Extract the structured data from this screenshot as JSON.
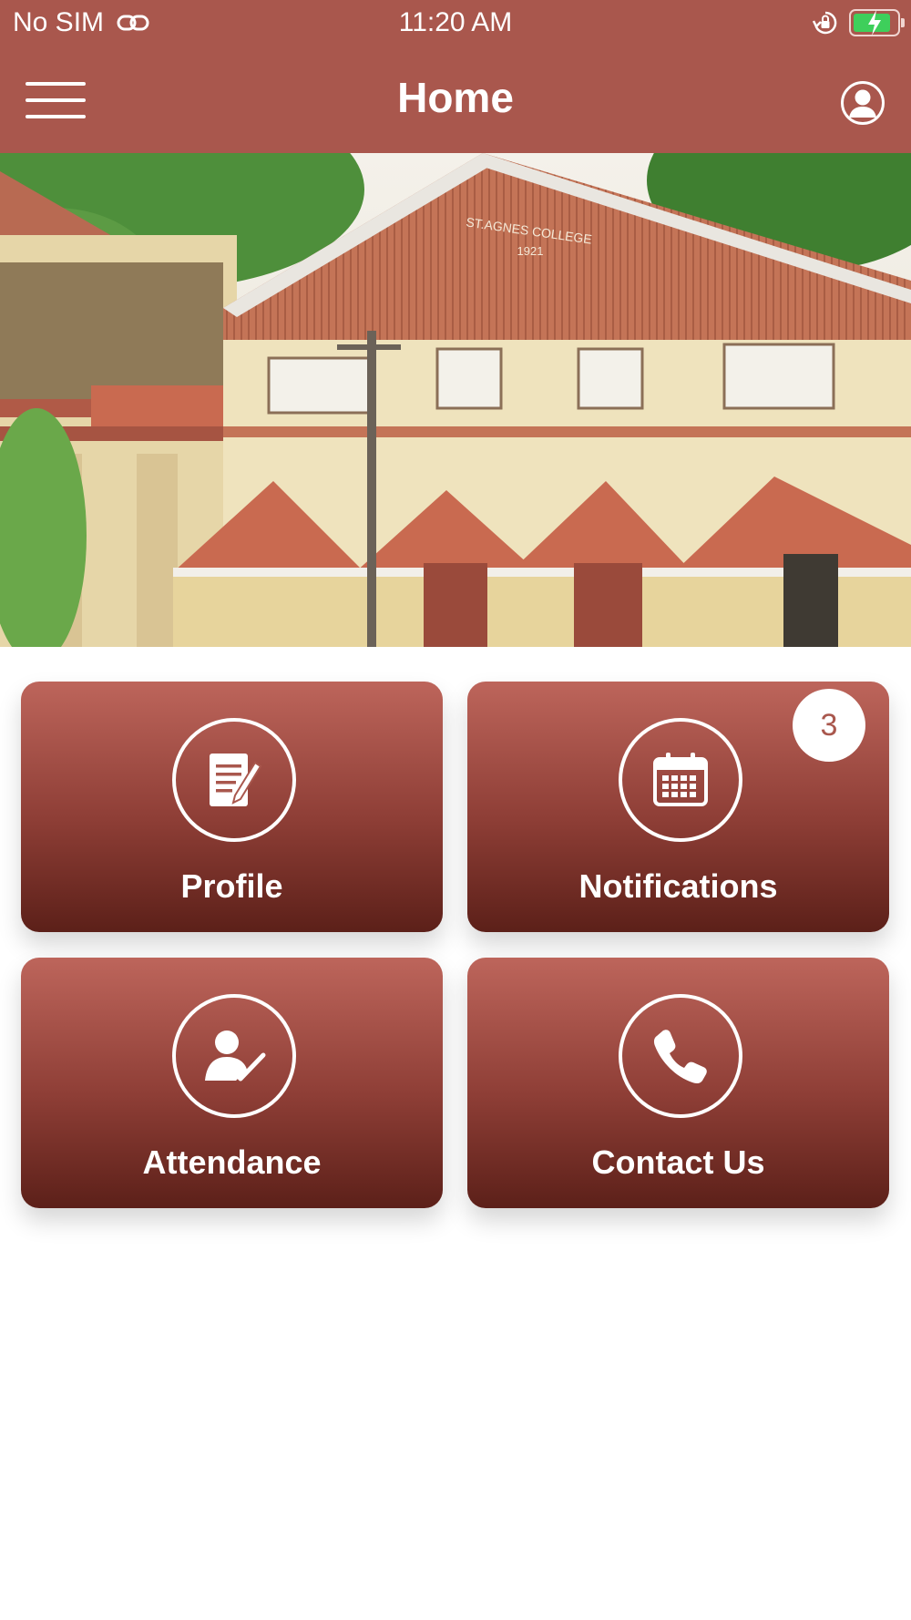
{
  "status_bar": {
    "carrier": "No SIM",
    "time": "11:20 AM",
    "link_icon": "link-icon",
    "rotation_lock_icon": "rotation-lock-icon",
    "battery_icon": "battery-charging-icon",
    "battery_fill_color": "#3ecf5b"
  },
  "nav": {
    "title": "Home",
    "menu_icon": "hamburger-menu-icon",
    "profile_icon": "user-account-icon"
  },
  "hero": {
    "building_sign_line1": "ST.AGNES COLLEGE",
    "building_sign_line2": "1921"
  },
  "tiles": [
    {
      "label": "Profile",
      "icon": "edit-document-icon"
    },
    {
      "label": "Notifications",
      "icon": "calendar-icon",
      "badge": "3"
    },
    {
      "label": "Attendance",
      "icon": "user-check-icon"
    },
    {
      "label": "Contact Us",
      "icon": "phone-icon"
    }
  ],
  "theme": {
    "primary": "#a9574d",
    "tile_gradient_top": "#bd655b",
    "tile_gradient_bottom": "#5c2019"
  }
}
